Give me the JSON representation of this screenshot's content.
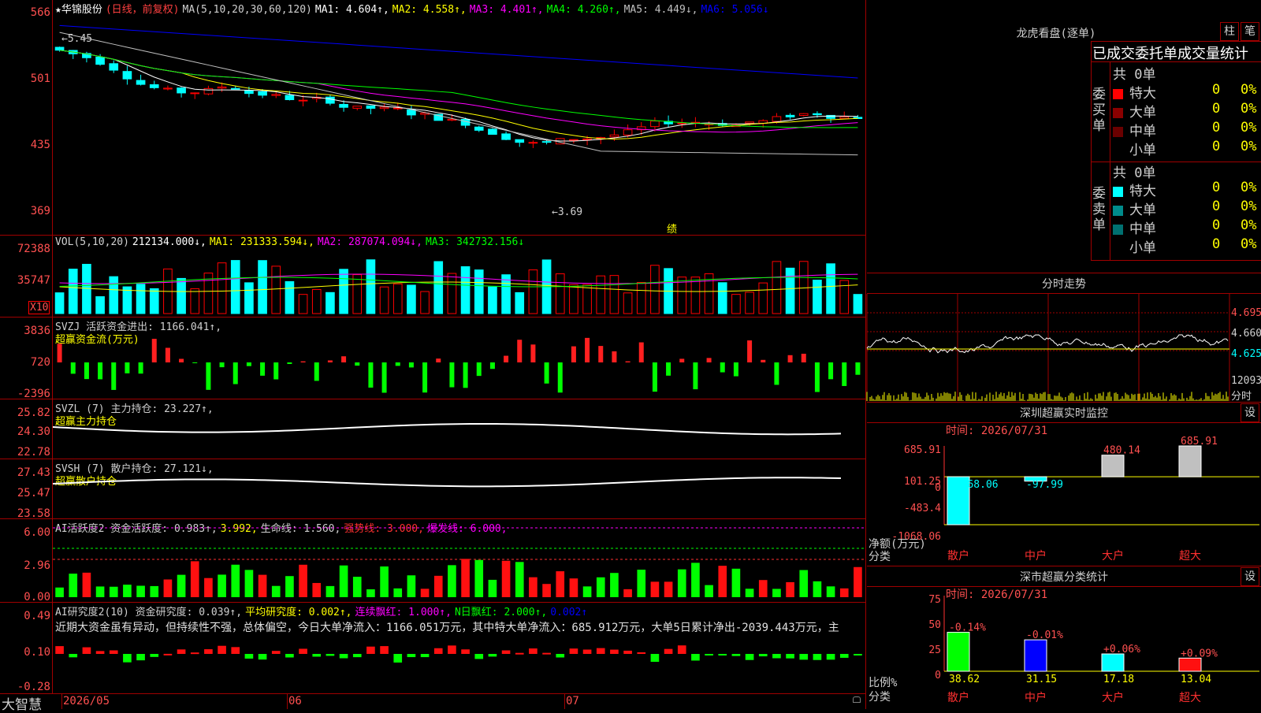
{
  "header": {
    "star": "★",
    "stock_name": "华锦股份",
    "period": "(日线，前复权)",
    "ma_label": "MA(5,10,20,30,60,120)",
    "ma1": "MA1: 4.604↑,",
    "ma2": "MA2: 4.558↑,",
    "ma3": "MA3: 4.401↑,",
    "ma4": "MA4: 4.260↑,",
    "ma5": "MA5: 4.449↓,",
    "ma6": "MA6: 5.056↓"
  },
  "price_axis": [
    "566",
    "501",
    "435",
    "369"
  ],
  "price_annotations": {
    "high": "5.45",
    "low": "3.69",
    "event": "绩"
  },
  "volume": {
    "title": "VOL(5,10,20)",
    "value": "212134.000↓,",
    "ma1": "MA1: 231333.594↓,",
    "ma2": "MA2: 287074.094↓,",
    "ma3": "MA3: 342732.156↓",
    "axis": [
      "72388",
      "35747"
    ],
    "unit": "X10"
  },
  "svzj": {
    "title": "SVZJ  活跃资金进出: 1166.041↑,",
    "subtitle": "超赢资金流(万元)",
    "axis": [
      "3836",
      "720",
      "-2396"
    ]
  },
  "svzl": {
    "title": "SVZL (7) 主力持仓: 23.227↑,",
    "subtitle": "超赢主力持仓",
    "axis": [
      "25.82",
      "24.30",
      "22.78"
    ]
  },
  "svsh": {
    "title": "SVSH (7) 散户持仓: 27.121↓,",
    "subtitle": "超赢散户持仓",
    "axis": [
      "27.43",
      "25.47",
      "23.58"
    ]
  },
  "ai_active": {
    "title": "AI活跃度2 资金活跃度: 0.983↑,",
    "v2": "3.992,",
    "life": "生命线: 1.560,",
    "strong": "强势线: 3.000,",
    "burst": "爆发线: 6.000,",
    "axis": [
      "6.00",
      "2.96",
      "0.00"
    ]
  },
  "ai_research": {
    "title": "AI研究度2(10) 资金研究度: 0.039↑,",
    "avg": "平均研究度: 0.002↑,",
    "streak": "连续飘红: 1.000↑,",
    "nday": "N日飘红: 2.000↑,",
    "last": "0.002↑",
    "comment": "近期大资金虽有异动，但持续性不强，总体偏空，今日大单净流入：1166.051万元，其中特大单净流入：685.912万元，大单5日累计净出-2039.443万元，主",
    "axis": [
      "0.49",
      "0.10",
      "-0.28"
    ]
  },
  "date_axis": {
    "logo": "大智慧",
    "d1": "2026/05",
    "d2": "06",
    "d3": "07"
  },
  "right_panel": {
    "longhu_title": "龙虎看盘(逐单)",
    "btn_bar": "柱",
    "btn_pen": "笔",
    "stats_title": "已成交委托单成交量统计",
    "buy_label": "委买单",
    "sell_label": "委卖单",
    "buy_total": "共 0单",
    "sell_total": "共 0单",
    "buy_rows": [
      {
        "label": "特大",
        "count": "0",
        "pct": "0%",
        "color": "#ff0000"
      },
      {
        "label": "大单",
        "count": "0",
        "pct": "0%",
        "color": "#8b0000"
      },
      {
        "label": "中单",
        "count": "0",
        "pct": "0%",
        "color": "#6a0000"
      },
      {
        "label": "小单",
        "count": "0",
        "pct": "0%",
        "color": "#000000"
      }
    ],
    "sell_rows": [
      {
        "label": "特大",
        "count": "0",
        "pct": "0%",
        "color": "#00ffff"
      },
      {
        "label": "大单",
        "count": "0",
        "pct": "0%",
        "color": "#008b8b"
      },
      {
        "label": "中单",
        "count": "0",
        "pct": "0%",
        "color": "#007070"
      },
      {
        "label": "小单",
        "count": "0",
        "pct": "0%",
        "color": "#000000"
      }
    ],
    "intraday_title": "分时走势",
    "intraday_axis": [
      "4.695",
      "4.660",
      "4.625",
      "12093",
      "分时"
    ],
    "monitor_title": "深圳超赢实时监控",
    "btn_set": "设",
    "monitor_time": "时间: 2026/07/31",
    "monitor_axis": [
      "685.91",
      "101.25",
      "0",
      "-483.4",
      "-1068.06"
    ],
    "monitor_ylabel": "净额(万元)",
    "monitor_xlabel": "分类",
    "class_title": "深市超赢分类统计",
    "class_time": "时间: 2026/07/31",
    "class_axis": [
      "75",
      "50",
      "25",
      "0"
    ],
    "class_ylabel": "比例%",
    "class_xlabel": "分类"
  },
  "chart_data": [
    {
      "type": "bar",
      "title": "深圳超赢实时监控",
      "ylabel": "净额(万元)",
      "xlabel": "分类",
      "categories": [
        "散户",
        "中户",
        "大户",
        "超大"
      ],
      "values": [
        -1068.06,
        -97.99,
        480.14,
        685.91
      ],
      "labels": [
        "-1068.06",
        "-97.99",
        "480.14",
        "685.91"
      ],
      "ylim": [
        -1068.06,
        685.91
      ]
    },
    {
      "type": "bar",
      "title": "深市超赢分类统计",
      "ylabel": "比例%",
      "xlabel": "分类",
      "categories": [
        "散户",
        "中户",
        "大户",
        "超大"
      ],
      "values": [
        38.62,
        31.15,
        17.18,
        13.04
      ],
      "changes": [
        "-0.14%",
        "-0.01%",
        "+0.06%",
        "+0.09%"
      ],
      "ylim": [
        0,
        75
      ]
    }
  ],
  "colors": {
    "up": "#ff0000",
    "down": "#00ffff",
    "grid": "#a00000",
    "ma1": "#ffffff",
    "ma2": "#ffff00",
    "ma3": "#ff00ff",
    "ma4": "#00ff00",
    "ma6": "#0000ff"
  }
}
